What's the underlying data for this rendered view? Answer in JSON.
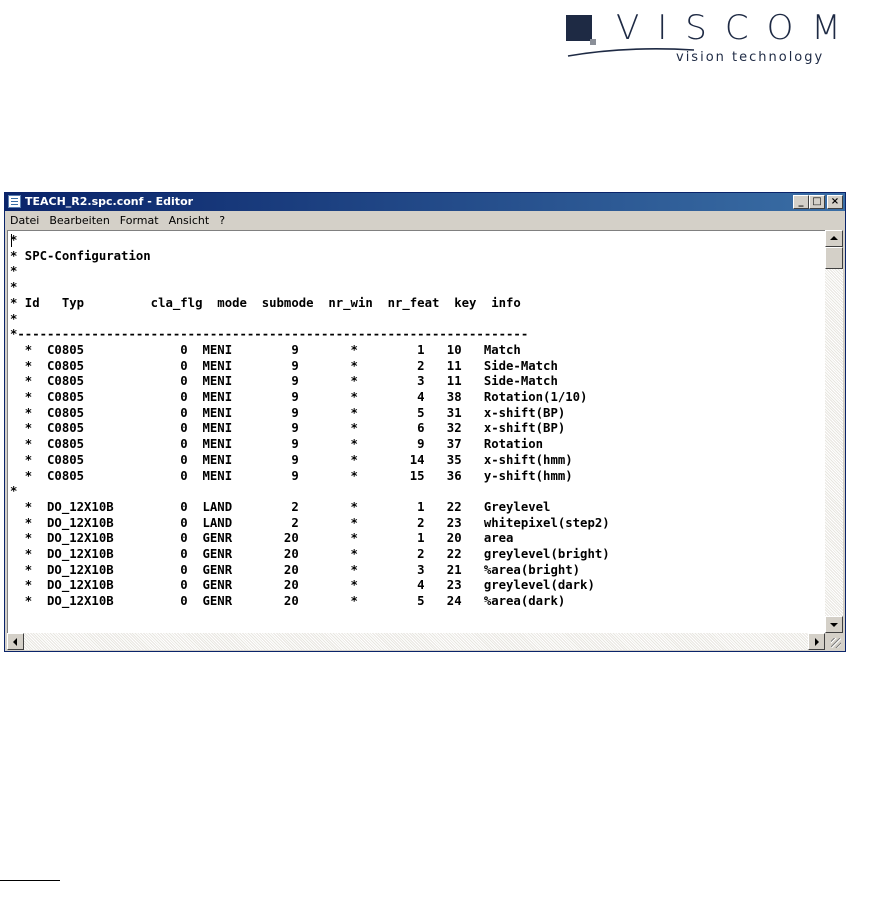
{
  "logo": {
    "word": "VISCOM",
    "tagline": "vision technology"
  },
  "window": {
    "title": "TEACH_R2.spc.conf - Editor",
    "buttons": {
      "minimize": "_",
      "maximize": "□",
      "close": "×"
    },
    "menu": [
      "Datei",
      "Bearbeiten",
      "Format",
      "Ansicht",
      "?"
    ]
  },
  "editor": {
    "content": "*\n* SPC-Configuration\n*\n*\n* Id   Typ         cla_flg  mode  submode  nr_win  nr_feat  key  info\n*\n*---------------------------------------------------------------------\n  *  C0805             0  MENI        9       *        1   10   Match\n  *  C0805             0  MENI        9       *        2   11   Side-Match\n  *  C0805             0  MENI        9       *        3   11   Side-Match\n  *  C0805             0  MENI        9       *        4   38   Rotation(1/10)\n  *  C0805             0  MENI        9       *        5   31   x-shift(BP)\n  *  C0805             0  MENI        9       *        6   32   x-shift(BP)\n  *  C0805             0  MENI        9       *        9   37   Rotation\n  *  C0805             0  MENI        9       *       14   35   x-shift(hmm)\n  *  C0805             0  MENI        9       *       15   36   y-shift(hmm)\n*\n  *  DO_12X10B         0  LAND        2       *        1   22   Greylevel\n  *  DO_12X10B         0  LAND        2       *        2   23   whitepixel(step2)\n  *  DO_12X10B         0  GENR       20       *        1   20   area\n  *  DO_12X10B         0  GENR       20       *        2   22   greylevel(bright)\n  *  DO_12X10B         0  GENR       20       *        3   21   %area(bright)\n  *  DO_12X10B         0  GENR       20       *        4   23   greylevel(dark)\n  *  DO_12X10B         0  GENR       20       *        5   24   %area(dark)"
  },
  "colors": {
    "titlebar_start": "#0a246a",
    "titlebar_end": "#3a6ea5",
    "chrome": "#d4d0c8",
    "logo": "#1e2a44"
  }
}
